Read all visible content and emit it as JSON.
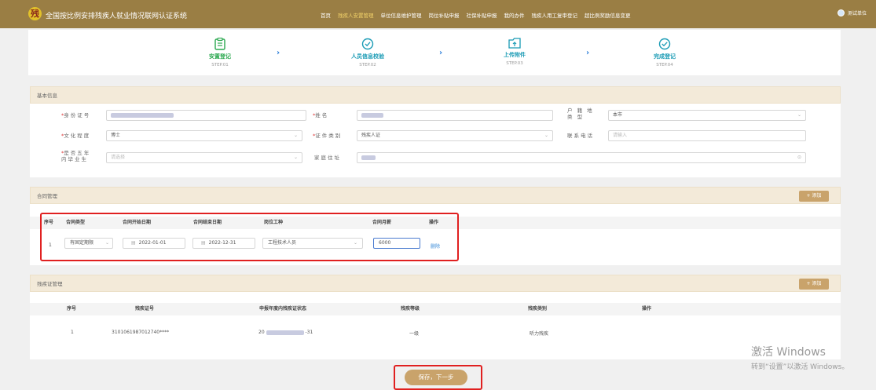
{
  "header": {
    "logo_glyph": "残",
    "app_title": "全国按比例安排残疾人就业情况联网认证系统",
    "nav": [
      "首页",
      "残疾人安置管理",
      "单位信息维护管理",
      "岗位补贴申报",
      "社保补贴申报",
      "我的办件",
      "残疾人用工复审登记",
      "超比例奖励信息变更"
    ],
    "active_nav": "残疾人安置管理",
    "user_label": "测试单位"
  },
  "steps": [
    {
      "label": "安置登记",
      "en": "STEP.01",
      "icon": "clipboard-icon"
    },
    {
      "label": "人员信息校验",
      "en": "STEP.02",
      "icon": "verify-icon"
    },
    {
      "label": "上传附件",
      "en": "STEP.03",
      "icon": "upload-folder-icon"
    },
    {
      "label": "完成登记",
      "en": "STEP.04",
      "icon": "check-circle-icon"
    }
  ],
  "step_arrow": "›",
  "basic": {
    "title": "基本信息",
    "id_label": "身份证号",
    "name_label": "姓名",
    "household_label_1": "户 籍 地",
    "household_label_2": "类 型",
    "household_value": "本市",
    "education_label": "文化程度",
    "education_value": "博士",
    "cert_type_label": "证件类别",
    "cert_type_value": "残疾人证",
    "phone_label": "联系电话",
    "phone_placeholder": "请输入",
    "grad_label_1": "是否五年",
    "grad_label_2": "内毕业生",
    "grad_placeholder": "请选择",
    "address_label": "家庭住址"
  },
  "contract": {
    "title": "合同管理",
    "add_label": "+ 添加",
    "columns": [
      "序号",
      "合同类型",
      "合同开始日期",
      "合同结束日期",
      "岗位工种",
      "合同月薪",
      "操作"
    ],
    "row": {
      "index": "1",
      "type": "有固定期限",
      "start": "2022-01-01",
      "end": "2022-12-31",
      "job": "工程技术人员",
      "salary": "6000",
      "action": "删除"
    }
  },
  "disability": {
    "title": "残疾证管理",
    "add_label": "+ 添加",
    "columns": [
      "序号",
      "残疾证号",
      "申报年度内残疾证状态",
      "残疾等级",
      "残疾类别",
      "操作"
    ],
    "row": {
      "index": "1",
      "cert_no": "3101061987012740****",
      "status_prefix": "20",
      "status_suffix": "-31",
      "level": "一级",
      "category": "听力残疾"
    }
  },
  "save_label": "保存，下一步",
  "watermark": {
    "line1": "激活 Windows",
    "line2": "转到“设置”以激活 Windows。"
  },
  "colors": {
    "header_bg": "#9a7e44",
    "accent_gold": "#c9a36b",
    "step_green": "#2aa84f",
    "step_teal": "#1a9bb5",
    "highlight_red": "#e02020"
  }
}
